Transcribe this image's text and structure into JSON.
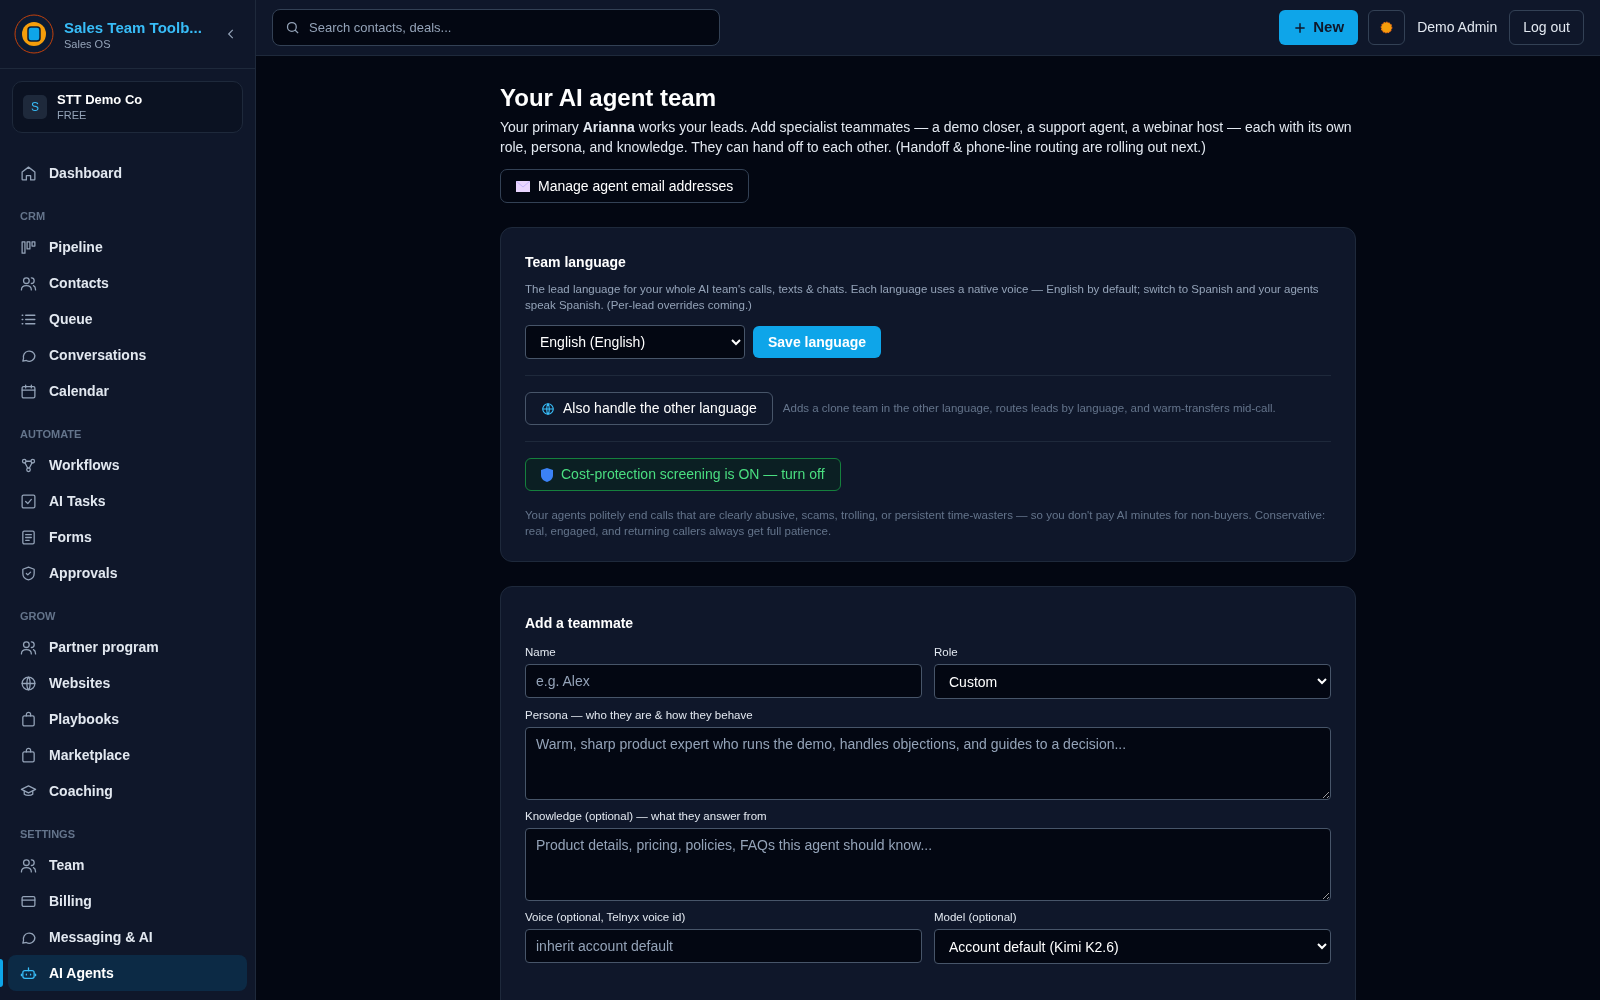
{
  "brand": {
    "title": "Sales Team Toolb...",
    "subtitle": "Sales OS"
  },
  "workspace": {
    "initial": "S",
    "name": "STT Demo Co",
    "plan": "FREE"
  },
  "sidebar": {
    "sections": [
      {
        "items": [
          {
            "label": "Dashboard",
            "selected": false
          }
        ]
      },
      {
        "heading": "CRM",
        "items": [
          {
            "label": "Pipeline",
            "selected": false
          },
          {
            "label": "Contacts",
            "selected": false
          },
          {
            "label": "Queue",
            "selected": false
          },
          {
            "label": "Conversations",
            "selected": false
          },
          {
            "label": "Calendar",
            "selected": false
          }
        ]
      },
      {
        "heading": "AUTOMATE",
        "items": [
          {
            "label": "Workflows",
            "selected": false
          },
          {
            "label": "AI Tasks",
            "selected": false
          },
          {
            "label": "Forms",
            "selected": false
          },
          {
            "label": "Approvals",
            "selected": false
          }
        ]
      },
      {
        "heading": "GROW",
        "items": [
          {
            "label": "Partner program",
            "selected": false
          },
          {
            "label": "Websites",
            "selected": false
          },
          {
            "label": "Playbooks",
            "selected": false
          },
          {
            "label": "Marketplace",
            "selected": false
          },
          {
            "label": "Coaching",
            "selected": false
          }
        ]
      },
      {
        "heading": "SETTINGS",
        "items": [
          {
            "label": "Team",
            "selected": false
          },
          {
            "label": "Billing",
            "selected": false
          },
          {
            "label": "Messaging & AI",
            "selected": false
          },
          {
            "label": "AI Agents",
            "selected": true
          }
        ]
      }
    ]
  },
  "topbar": {
    "search": {
      "placeholder": "Search contacts, deals..."
    },
    "new_button": "New",
    "user": "Demo Admin",
    "logout": "Log out"
  },
  "page": {
    "title": "Your AI agent team",
    "intro": "Your primary **Arianna** works your leads. Add specialist teammates — a demo closer, a support agent, a webinar host — each with its own role, persona, and knowledge. They can hand off to each other. (Handoff & phone-line routing are rolling out next.)",
    "email_button": "Manage agent email addresses"
  },
  "team_language": {
    "title": "Team language",
    "description": "The lead language for your whole AI team's calls, texts & chats. Each language uses a native voice — English by default; switch to Spanish and your agents speak Spanish. (Per-lead overrides coming.)",
    "language": "English (English)",
    "save_button": "Save language",
    "other_language_button": "Also handle the other language",
    "other_language_hint": "Adds a clone team in the other language, routes leads by language, and warm-transfers mid-call.",
    "screening": {
      "on": true,
      "label": "Cost-protection screening is ON — turn off"
    },
    "screening_description": "Your agents politely end calls that are clearly abusive, scams, trolling, or persistent time-wasters — so you don't pay AI minutes for non-buyers. Conservative: real, engaged, and returning callers always get full patience."
  },
  "add_teammate": {
    "title": "Add a teammate",
    "fields": [
      {
        "kind": "input",
        "label": "Name",
        "placeholder": "e.g. Alex"
      },
      {
        "kind": "select",
        "label": "Role",
        "value": "Custom"
      },
      {
        "kind": "textarea",
        "label": "Persona — who they are & how they behave",
        "placeholder": "Warm, sharp product expert who runs the demo, handles objections, and guides to a decision..."
      },
      {
        "kind": "textarea",
        "label": "Knowledge (optional) — what they answer from",
        "placeholder": "Product details, pricing, policies, FAQs this agent should know..."
      },
      {
        "kind": "input",
        "label": "Voice (optional, Telnyx voice id)",
        "placeholder": "inherit account default"
      },
      {
        "kind": "select",
        "label": "Model (optional)",
        "value": "Account default (Kimi K2.6)"
      }
    ]
  }
}
